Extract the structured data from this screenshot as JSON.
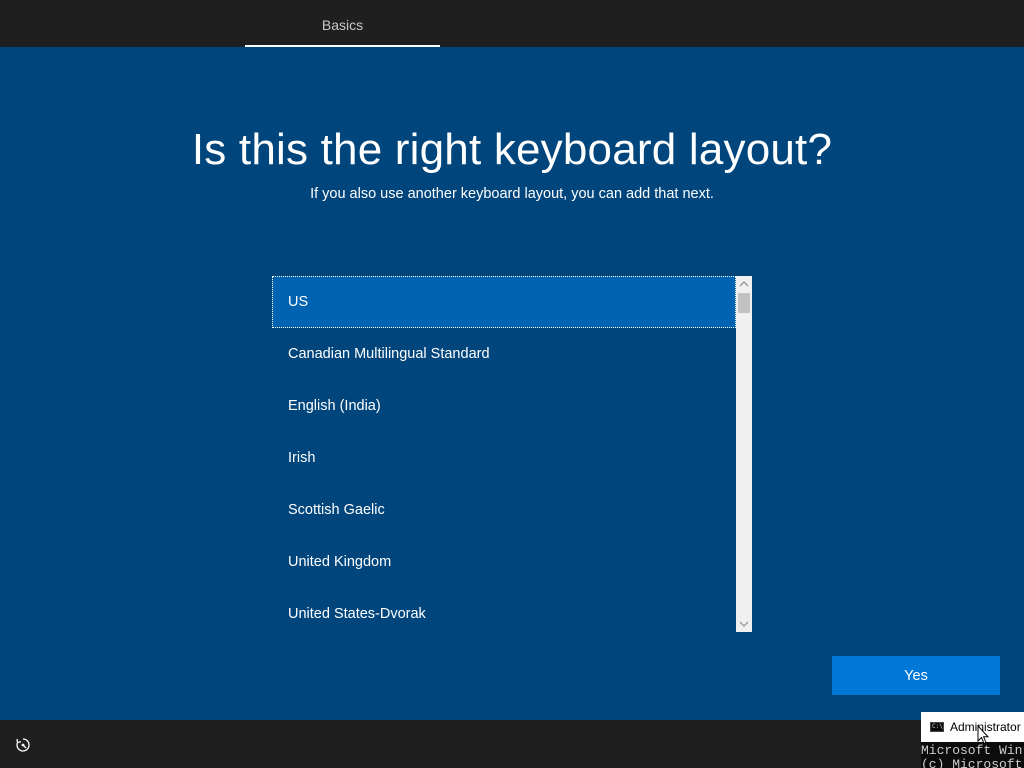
{
  "header": {
    "tab_label": "Basics"
  },
  "main": {
    "title": "Is this the right keyboard layout?",
    "subtitle": "If you also use another keyboard layout, you can add that next.",
    "layouts": [
      {
        "label": "US",
        "selected": true
      },
      {
        "label": "Canadian Multilingual Standard",
        "selected": false
      },
      {
        "label": "English (India)",
        "selected": false
      },
      {
        "label": "Irish",
        "selected": false
      },
      {
        "label": "Scottish Gaelic",
        "selected": false
      },
      {
        "label": "United Kingdom",
        "selected": false
      },
      {
        "label": "United States-Dvorak",
        "selected": false
      }
    ],
    "confirm_label": "Yes"
  },
  "cmd": {
    "title": "Administrator",
    "icon_text": "C:\\",
    "lines": [
      "Microsoft Win",
      "(c) Microsoft"
    ]
  },
  "colors": {
    "background": "#00457c",
    "selected": "#0063b1",
    "accent_button": "#0078d7",
    "chrome": "#1f1f1f"
  },
  "icons": {
    "accessibility": "ease-of-access-icon",
    "scroll_up": "chevron-up-icon",
    "scroll_down": "chevron-down-icon",
    "cmd": "command-prompt-icon",
    "cursor": "mouse-pointer-icon"
  }
}
